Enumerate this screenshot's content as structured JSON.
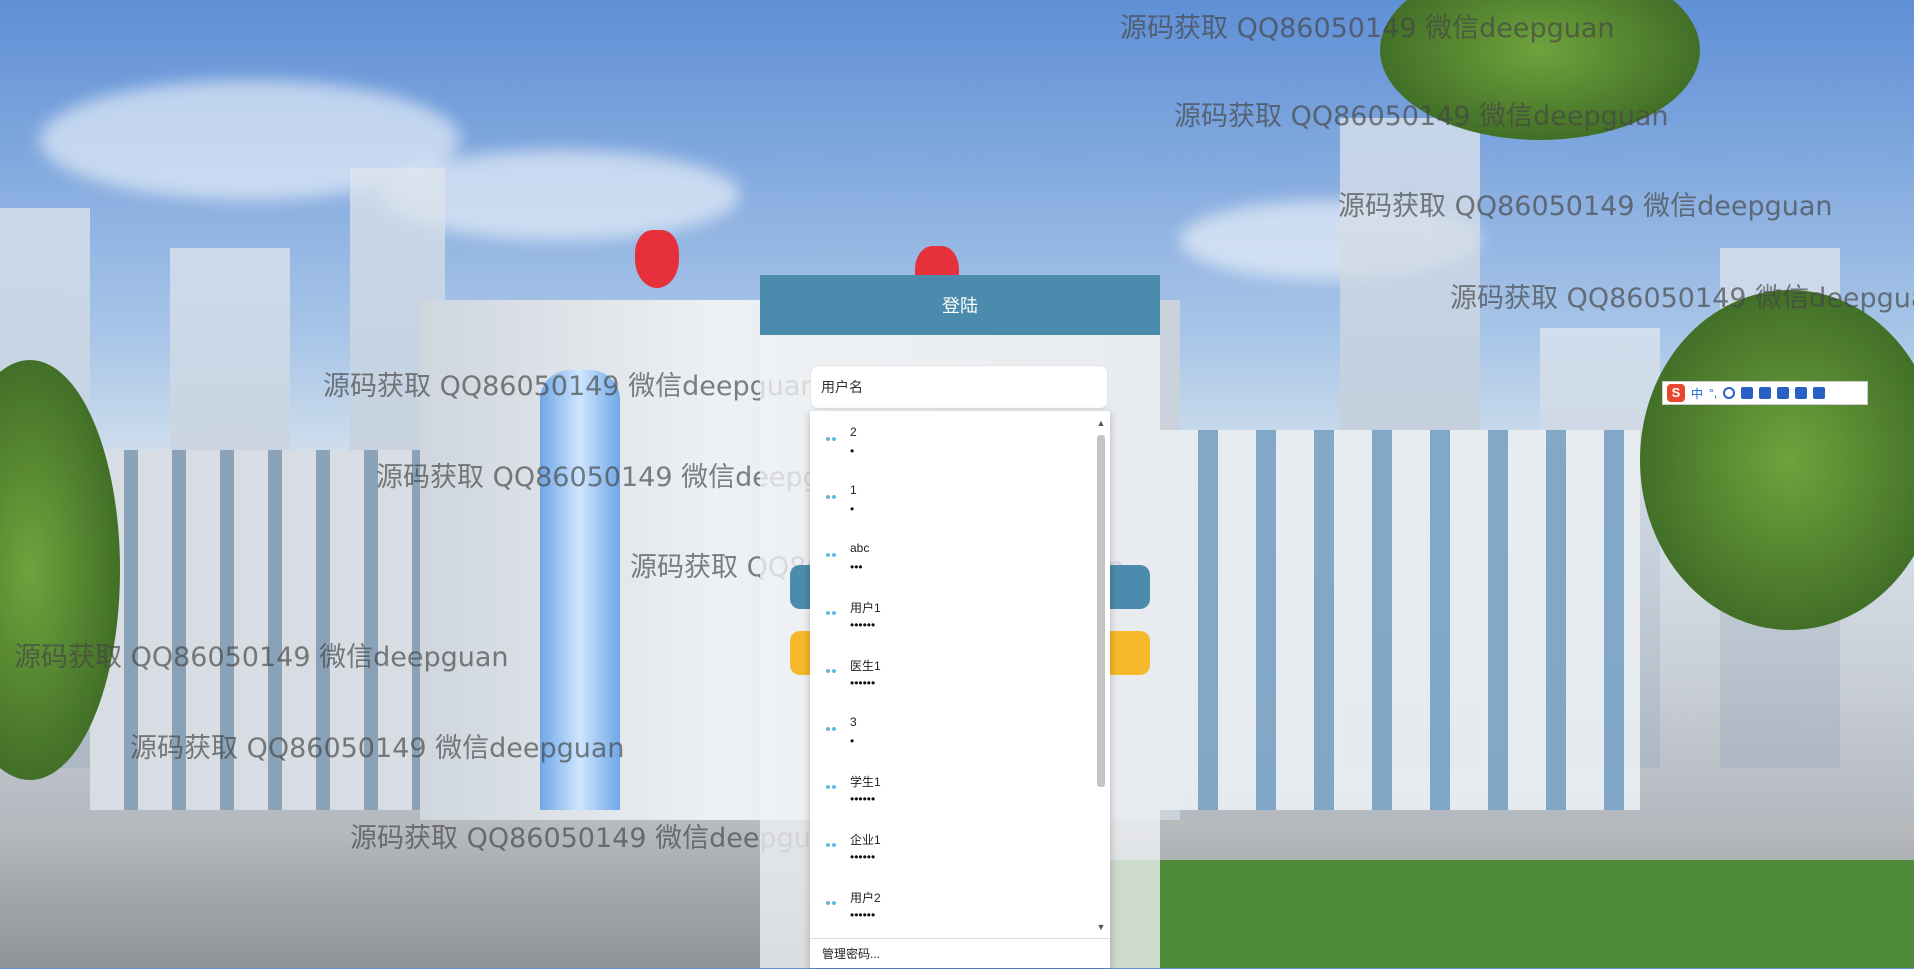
{
  "login": {
    "title": "登陆",
    "account_value": "用户名",
    "manage_passwords": "管理密码..."
  },
  "suggestions": [
    {
      "name": "2",
      "password": "•"
    },
    {
      "name": "1",
      "password": "•"
    },
    {
      "name": "abc",
      "password": "•••"
    },
    {
      "name": "用户1",
      "password": "••••••"
    },
    {
      "name": "医生1",
      "password": "••••••"
    },
    {
      "name": "3",
      "password": "•"
    },
    {
      "name": "学生1",
      "password": "••••••"
    },
    {
      "name": "企业1",
      "password": "••••••"
    },
    {
      "name": "用户2",
      "password": "••••••"
    }
  ],
  "watermark_text": "源码获取 QQ86050149 微信deepguan",
  "ime_toolbar": {
    "logo": "S",
    "mode": "中",
    "punct": "°,"
  },
  "colors": {
    "header": "#4b8cae",
    "login_button": "#4b8cae",
    "register_button": "#f7b92b",
    "key_icon": "#66b8e3"
  }
}
